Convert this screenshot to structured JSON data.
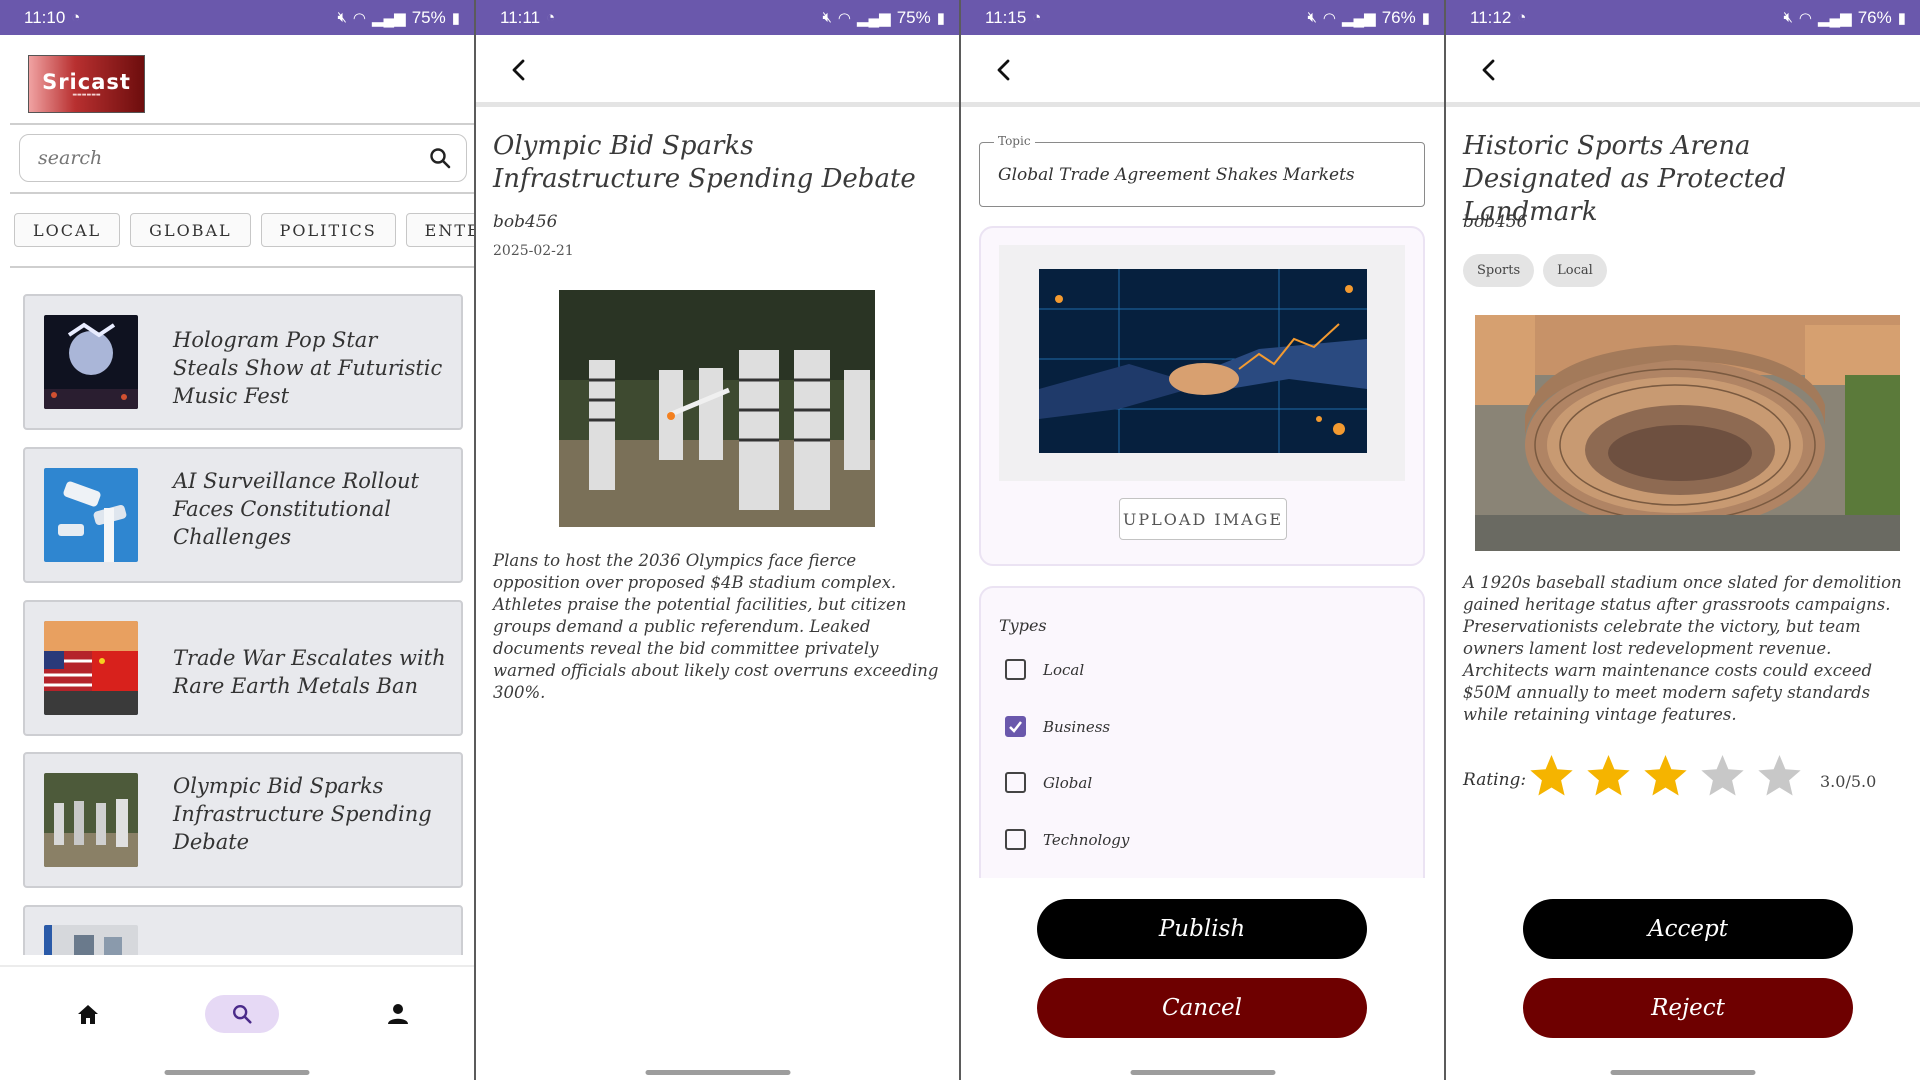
{
  "colors": {
    "statusbar": "#6a58ac",
    "card_bg": "#e8e9ed",
    "accept": "#000000",
    "reject": "#6e0000",
    "star_on": "#f5b400",
    "star_off": "#c8c8c8"
  },
  "screens": [
    {
      "status": {
        "time": "11:10",
        "battery": "75%"
      },
      "logo": {
        "text": "Sricast"
      },
      "search": {
        "placeholder": "search"
      },
      "chips": [
        "LOCAL",
        "GLOBAL",
        "POLITICS",
        "ENTERTAI"
      ],
      "news": [
        {
          "title": "Hologram Pop Star Steals Show at Futuristic Music Fest"
        },
        {
          "title": "AI Surveillance Rollout Faces Constitutional Challenges"
        },
        {
          "title": "Trade War Escalates with Rare Earth Metals Ban"
        },
        {
          "title": "Olympic Bid Sparks Infrastructure Spending Debate"
        }
      ],
      "nav": [
        "home-icon",
        "search-icon",
        "person-icon"
      ]
    },
    {
      "status": {
        "time": "11:11",
        "battery": "75%"
      },
      "title": "Olympic Bid Sparks Infrastructure Spending Debate",
      "author": "bob456",
      "date": "2025-02-21",
      "body": "Plans to host the 2036 Olympics face fierce opposition over proposed $4B stadium complex. Athletes praise the potential facilities, but citizen groups demand a public referendum. Leaked documents reveal the bid committee privately warned officials about likely cost overruns exceeding 300%."
    },
    {
      "status": {
        "time": "11:15",
        "battery": "76%"
      },
      "topic_label": "Topic",
      "topic_value": "Global Trade Agreement Shakes Markets",
      "upload_label": "UPLOAD IMAGE",
      "types_label": "Types",
      "types": [
        {
          "label": "Local",
          "checked": false
        },
        {
          "label": "Business",
          "checked": true
        },
        {
          "label": "Global",
          "checked": false
        },
        {
          "label": "Technology",
          "checked": false
        }
      ],
      "publish_label": "Publish",
      "cancel_label": "Cancel"
    },
    {
      "status": {
        "time": "11:12",
        "battery": "76%"
      },
      "title": "Historic Sports Arena Designated as Protected Landmark",
      "author": "bob456",
      "tags": [
        "Sports",
        "Local"
      ],
      "body": "A 1920s baseball stadium once slated for demolition gained heritage status after grassroots campaigns. Preservationists celebrate the victory, but team owners lament lost redevelopment revenue. Architects warn maintenance costs could exceed $50M annually to meet modern safety standards while retaining vintage features.",
      "rating_label": "Rating:",
      "rating": 3,
      "rating_max": 5,
      "rating_text": "3.0/5.0",
      "accept_label": "Accept",
      "reject_label": "Reject"
    }
  ]
}
